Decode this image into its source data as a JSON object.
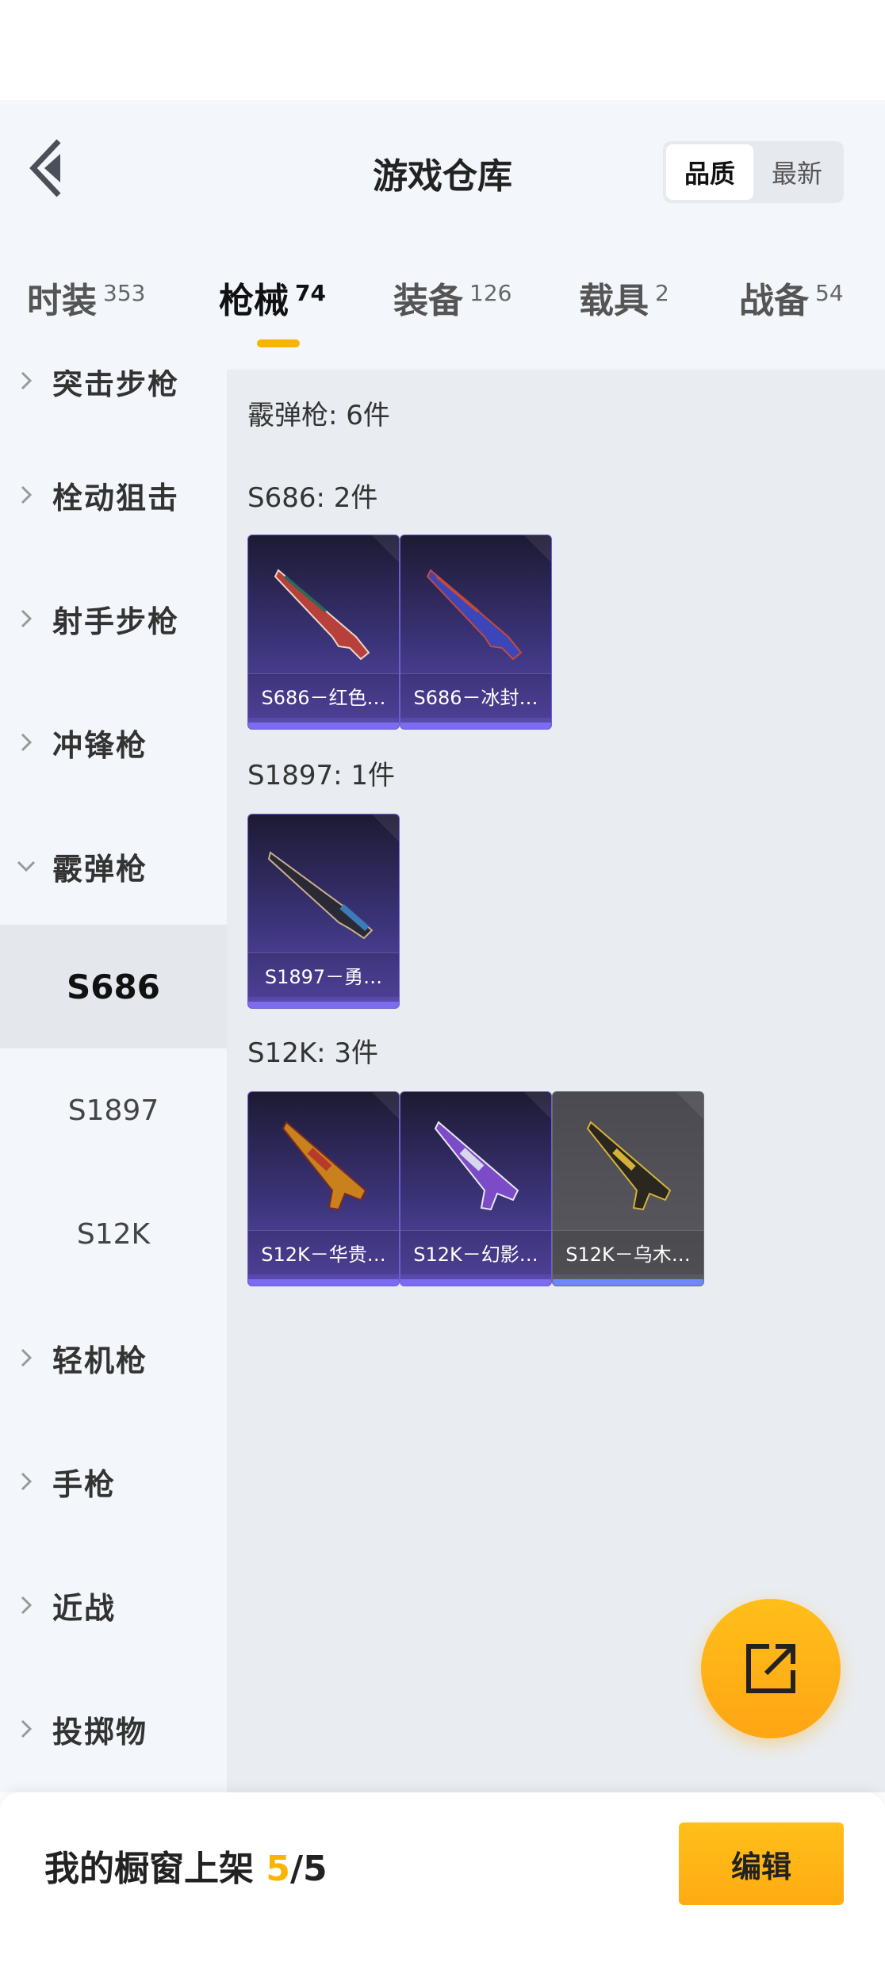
{
  "header": {
    "title": "游戏仓库",
    "sort_options": [
      "品质",
      "最新"
    ],
    "active_sort": 0
  },
  "tabs": [
    {
      "label": "时装",
      "count": "353"
    },
    {
      "label": "枪械",
      "count": "74"
    },
    {
      "label": "装备",
      "count": "126"
    },
    {
      "label": "载具",
      "count": "2"
    },
    {
      "label": "战备",
      "count": "54"
    }
  ],
  "sidebar": {
    "partial_top": "突击步枪",
    "items": [
      {
        "label": "栓动狙击"
      },
      {
        "label": "射手步枪"
      },
      {
        "label": "冲锋枪"
      },
      {
        "label": "霰弹枪"
      },
      {
        "label": "S686"
      },
      {
        "label": "S1897"
      },
      {
        "label": "S12K"
      },
      {
        "label": "轻机枪"
      },
      {
        "label": "手枪"
      },
      {
        "label": "近战"
      },
      {
        "label": "投掷物"
      }
    ]
  },
  "main": {
    "category_title": "霰弹枪: 6件",
    "groups": [
      {
        "title": "S686: 2件",
        "items": [
          {
            "name": "S686－红色…"
          },
          {
            "name": "S686－冰封…"
          }
        ]
      },
      {
        "title": "S1897: 1件",
        "items": [
          {
            "name": "S1897－勇…"
          }
        ]
      },
      {
        "title": "S12K: 3件",
        "items": [
          {
            "name": "S12K－华贵…"
          },
          {
            "name": "S12K－幻影…"
          },
          {
            "name": "S12K－乌木…"
          }
        ]
      }
    ]
  },
  "bottom": {
    "label": "我的橱窗上架",
    "current": "5",
    "total": "/5",
    "edit_label": "编辑"
  },
  "colors": {
    "accent": "#f8b400",
    "card_purple": "#3b3378",
    "background": "#e9ecf0"
  },
  "icons": {
    "back": "back-chevron-icon",
    "share": "share-external-icon"
  }
}
